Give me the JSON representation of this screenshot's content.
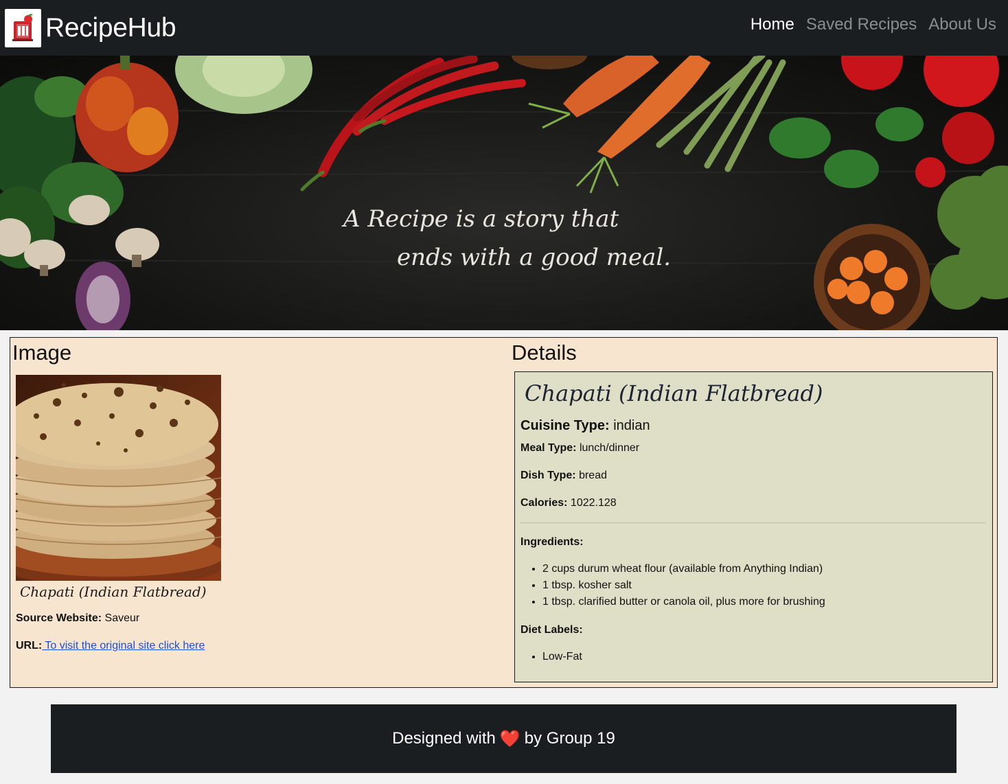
{
  "navbar": {
    "brand": "RecipeHub",
    "links": [
      {
        "label": "Home",
        "active": true
      },
      {
        "label": "Saved Recipes",
        "active": false
      },
      {
        "label": "About Us",
        "active": false
      }
    ]
  },
  "hero": {
    "quote_line1": "A Recipe is a story that",
    "quote_line2": "ends with a good meal."
  },
  "main": {
    "image_heading": "Image",
    "details_heading": "Details",
    "image_caption": "Chapati (Indian Flatbread)",
    "source_label": "Source Website:",
    "source_value": "Saveur",
    "url_label": "URL:",
    "url_link_text": " To visit the original site click here"
  },
  "details": {
    "title": "Chapati (Indian Flatbread)",
    "cuisine_label": "Cuisine Type:",
    "cuisine_value": "indian",
    "meal_label": "Meal Type:",
    "meal_value": "lunch/dinner",
    "dish_label": "Dish Type:",
    "dish_value": "bread",
    "calories_label": "Calories:",
    "calories_value": "1022.128",
    "ingredients_label": "Ingredients:",
    "ingredients": [
      "2 cups durum wheat flour (available from Anything Indian)",
      "1 tbsp. kosher salt",
      "1 tbsp. clarified butter or canola oil, plus more for brushing"
    ],
    "diet_label": "Diet Labels:",
    "diet_labels": [
      "Low-Fat"
    ]
  },
  "footer": {
    "text_before": "Designed with",
    "heart": "❤️",
    "text_after": "by Group 19"
  },
  "colors": {
    "navbar_bg": "#1b1e21",
    "main_bg": "#f8e5d0",
    "details_bg": "#dfdfc7",
    "link": "#1a4fd6",
    "heart": "#e0242b"
  },
  "icons": {
    "logo": "recipe-book-apple-logo",
    "heart": "heart-icon"
  }
}
